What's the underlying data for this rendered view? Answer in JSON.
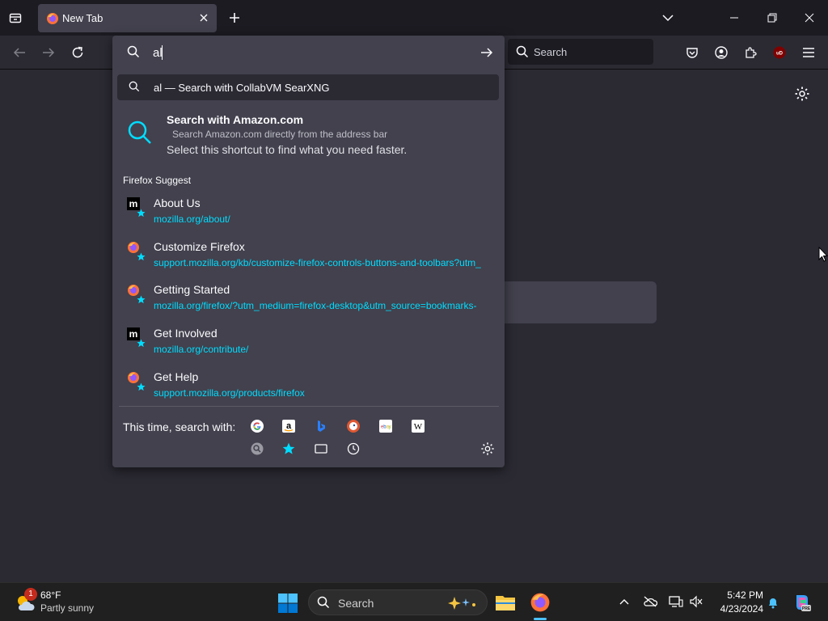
{
  "browser": {
    "tab": {
      "title": "New Tab"
    },
    "searchbar": {
      "placeholder": "Search"
    }
  },
  "urlbar": {
    "value": "al",
    "heuristic": {
      "text": "al — Search with CollabVM SearXNG"
    },
    "tip": {
      "title": "Search with Amazon.com",
      "description": "Search Amazon.com directly from the address bar",
      "subtitle": "Select this shortcut to find what you need faster."
    },
    "group_label": "Firefox Suggest",
    "results": [
      {
        "title": "About Us",
        "url": "mozilla.org/about/",
        "favicon": "mozilla-m-icon"
      },
      {
        "title": "Customize Firefox",
        "url": "support.mozilla.org/kb/customize-firefox-controls-buttons-and-toolbars?utm_",
        "favicon": "firefox-icon"
      },
      {
        "title": "Getting Started",
        "url": "mozilla.org/firefox/?utm_medium=firefox-desktop&utm_source=bookmarks-",
        "favicon": "firefox-icon"
      },
      {
        "title": "Get Involved",
        "url": "mozilla.org/contribute/",
        "favicon": "mozilla-m-icon"
      },
      {
        "title": "Get Help",
        "url": "support.mozilla.org/products/firefox",
        "favicon": "firefox-icon"
      }
    ],
    "oneoff_label": "This time, search with:",
    "oneoff_engines": [
      "google-icon",
      "amazon-icon",
      "bing-icon",
      "duckduckgo-icon",
      "ebay-icon",
      "wikipedia-icon"
    ],
    "oneoff_local": [
      "searxng-icon",
      "bookmarks-star-icon",
      "tabs-icon",
      "history-icon"
    ]
  },
  "taskbar": {
    "weather": {
      "temp": "68°F",
      "condition": "Partly sunny",
      "badge": "1"
    },
    "search_placeholder": "Search",
    "clock": {
      "time": "5:42 PM",
      "date": "4/23/2024"
    }
  },
  "colors": {
    "accent": "#00ddff",
    "popup_bg": "#42414d",
    "toolbar_bg": "#2b2a33",
    "tab_strip_bg": "#1c1b22",
    "taskbar_bg": "#202020",
    "ublock_red": "#800000"
  }
}
